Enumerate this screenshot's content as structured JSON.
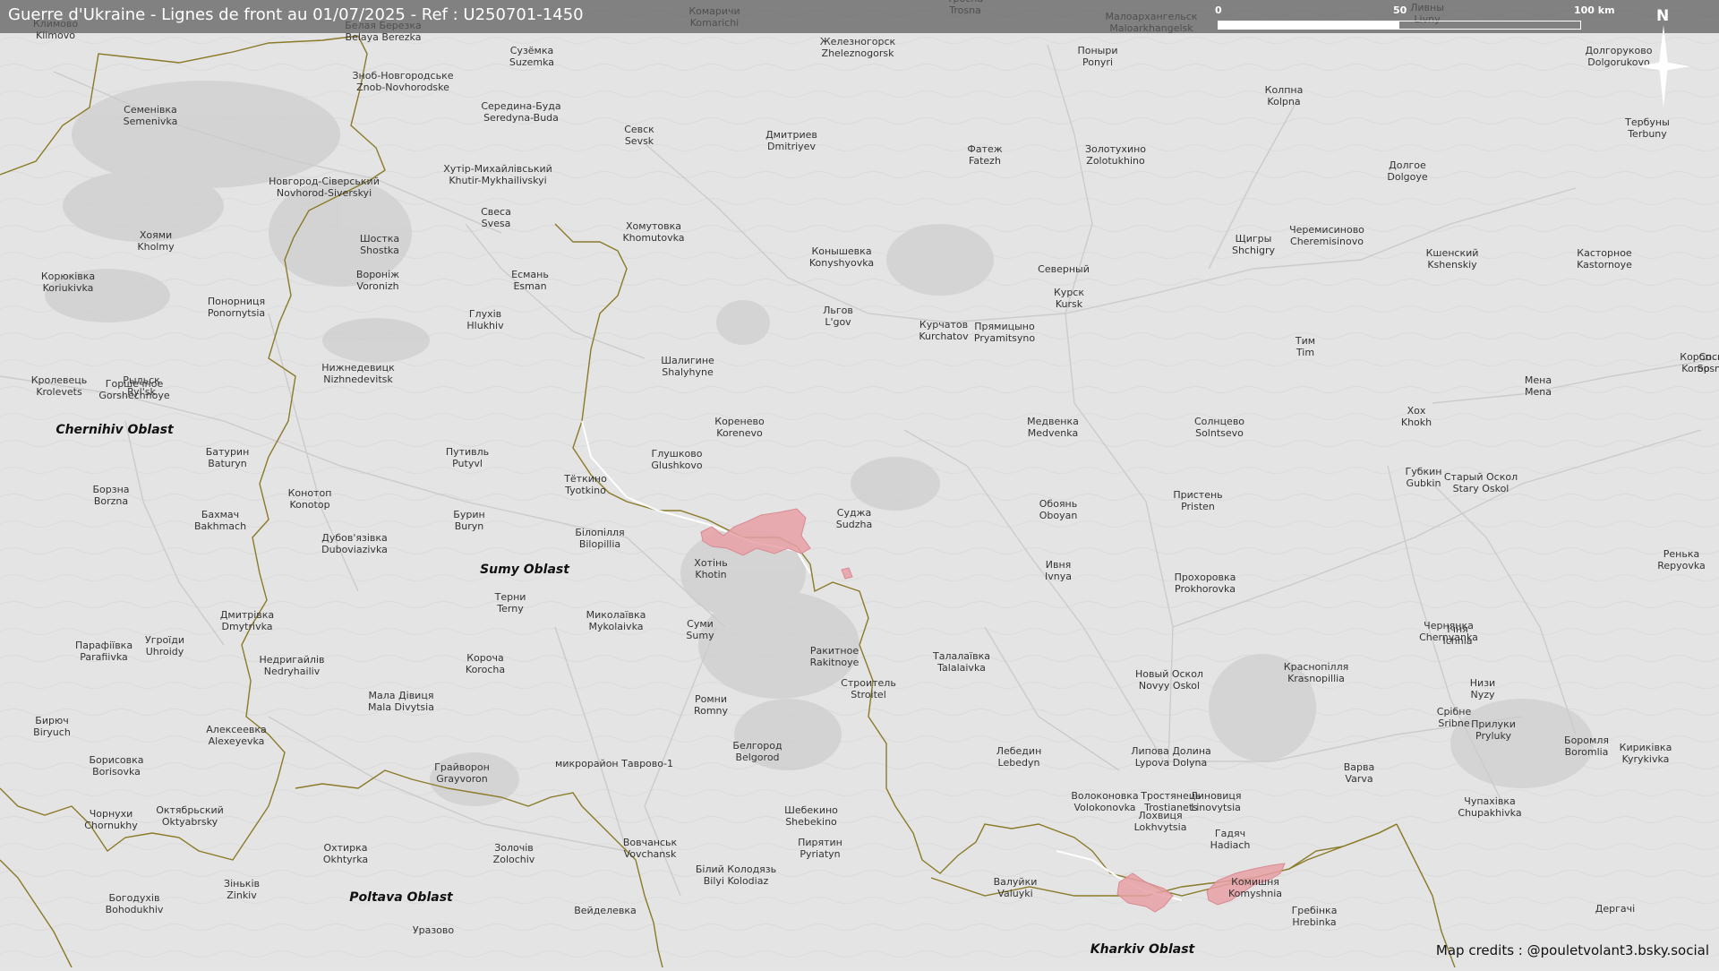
{
  "header": {
    "title": "Guerre d'Ukraine - Lignes de front au 01/07/2025 - Ref : U250701-1450",
    "scale_labels": [
      "0",
      "50",
      "100 km"
    ],
    "north_label": "N"
  },
  "footer": {
    "credits": "Map credits : @pouletvolant3.bsky.social"
  },
  "colors": {
    "occupied": "#e8a0a6",
    "border": "#8a7a28",
    "frontline": "#ffffff",
    "header_bg": "#5a5a5a"
  },
  "oblasts": [
    {
      "name": "Chernihiv Oblast"
    },
    {
      "name": "Sumy Oblast"
    },
    {
      "name": "Poltava Oblast"
    },
    {
      "name": "Kharkiv Oblast"
    }
  ],
  "places": [
    {
      "l1": "Комаричи",
      "l2": "Komarichi"
    },
    {
      "l1": "Тросна",
      "l2": "Trosna"
    },
    {
      "l1": "Малоархангельск",
      "l2": "Maloarkhangelsk"
    },
    {
      "l1": "Ливны",
      "l2": "Livny"
    },
    {
      "l1": "Климово",
      "l2": "Klimovo"
    },
    {
      "l1": "Белая Березка",
      "l2": "Belaya Berezka"
    },
    {
      "l1": "Сузёмка",
      "l2": "Suzemka"
    },
    {
      "l1": "Железногорск",
      "l2": "Zheleznogorsk"
    },
    {
      "l1": "Поныри",
      "l2": "Ponyri"
    },
    {
      "l1": "Долгоруково",
      "l2": "Dolgorukovo"
    },
    {
      "l1": "Зноб-Новгородське",
      "l2": "Znob-Novhorodske"
    },
    {
      "l1": "Семенівка",
      "l2": "Semenivka"
    },
    {
      "l1": "Середина-Буда",
      "l2": "Seredyna-Buda"
    },
    {
      "l1": "Севск",
      "l2": "Sevsk"
    },
    {
      "l1": "Дмитриев",
      "l2": "Dmitriyev"
    },
    {
      "l1": "Колпна",
      "l2": "Kolpna"
    },
    {
      "l1": "Тербуны",
      "l2": "Terbuny"
    },
    {
      "l1": "Фатеж",
      "l2": "Fatezh"
    },
    {
      "l1": "Золотухино",
      "l2": "Zolotukhino"
    },
    {
      "l1": "Долгое",
      "l2": "Dolgoye"
    },
    {
      "l1": "Новгород-Сіверський",
      "l2": "Novhorod-Siverskyi"
    },
    {
      "l1": "Хутір-Михайлівський",
      "l2": "Khutir-Mykhailivskyi"
    },
    {
      "l1": "Свеса",
      "l2": "Svesa"
    },
    {
      "l1": "Хомутовка",
      "l2": "Khomutovka"
    },
    {
      "l1": "Хоями",
      "l2": "Kholmy"
    },
    {
      "l1": "Шостка",
      "l2": "Shostka"
    },
    {
      "l1": "Конышевка",
      "l2": "Konyshyovka"
    },
    {
      "l1": "Щигры",
      "l2": "Shchigry"
    },
    {
      "l1": "Черемисиново",
      "l2": "Cheremisinovo"
    },
    {
      "l1": "Кшенский",
      "l2": "Kshenskiy"
    },
    {
      "l1": "Касторное",
      "l2": "Kastornoye"
    },
    {
      "l1": "Корюківка",
      "l2": "Koriukivka"
    },
    {
      "l1": "Вороніж",
      "l2": "Voronizh"
    },
    {
      "l1": "Есмань",
      "l2": "Esman"
    },
    {
      "l1": "Северный",
      "l2": ""
    },
    {
      "l1": "Курск",
      "l2": "Kursk"
    },
    {
      "l1": "Понорниця",
      "l2": "Ponornytsia"
    },
    {
      "l1": "Глухів",
      "l2": "Hlukhiv"
    },
    {
      "l1": "Льгов",
      "l2": "L'gov"
    },
    {
      "l1": "Курчатов",
      "l2": "Kurchatov"
    },
    {
      "l1": "Прямицыно",
      "l2": "Pryamitsyno"
    },
    {
      "l1": "Тим",
      "l2": "Tim"
    },
    {
      "l1": "Короп",
      "l2": "Korop"
    },
    {
      "l1": "Шалигине",
      "l2": "Shalyhyne"
    },
    {
      "l1": "Рыльск",
      "l2": "Ryl'sk"
    },
    {
      "l1": "Нижнедевицк",
      "l2": "Nizhnedevitsk"
    },
    {
      "l1": "Мена",
      "l2": "Mena"
    },
    {
      "l1": "Сосниця",
      "l2": "Sosnytsia"
    },
    {
      "l1": "Кролевець",
      "l2": "Krolevets"
    },
    {
      "l1": "Горшечное",
      "l2": "Gorshechnoye"
    },
    {
      "l1": "Хох",
      "l2": "Khokh"
    },
    {
      "l1": "Кореневo",
      "l2": "Korenevo"
    },
    {
      "l1": "Медвенка",
      "l2": "Medvenka"
    },
    {
      "l1": "Солнцево",
      "l2": "Solntsevo"
    },
    {
      "l1": "Путивль",
      "l2": "Putyvl"
    },
    {
      "l1": "Глушково",
      "l2": "Glushkovo"
    },
    {
      "l1": "Батурин",
      "l2": "Baturyn"
    },
    {
      "l1": "Тёткино",
      "l2": "Tyotkino"
    },
    {
      "l1": "Губкин",
      "l2": "Gubkin"
    },
    {
      "l1": "Старый Оскол",
      "l2": "Stary Oskol"
    },
    {
      "l1": "Борзна",
      "l2": "Borzna"
    },
    {
      "l1": "Конотоп",
      "l2": "Konotop"
    },
    {
      "l1": "Пристень",
      "l2": "Pristen"
    },
    {
      "l1": "Бахмач",
      "l2": "Bakhmach"
    },
    {
      "l1": "Бурин",
      "l2": "Buryn"
    },
    {
      "l1": "Суджа",
      "l2": "Sudzha"
    },
    {
      "l1": "Обоянь",
      "l2": "Oboyan"
    },
    {
      "l1": "Білопілля",
      "l2": "Bilopillia"
    },
    {
      "l1": "Дубов'язівка",
      "l2": "Duboviazivka"
    },
    {
      "l1": "Хотінь",
      "l2": "Khotin"
    },
    {
      "l1": "Ивня",
      "l2": "Ivnya"
    },
    {
      "l1": "Ренька",
      "l2": "Repyovka"
    },
    {
      "l1": "Прохоровка",
      "l2": "Prokhorovka"
    },
    {
      "l1": "Терни",
      "l2": "Terny"
    },
    {
      "l1": "Миколаївка",
      "l2": "Mykolaivka"
    },
    {
      "l1": "Чернянка",
      "l2": "Chernyanka"
    },
    {
      "l1": "Дмитрівка",
      "l2": "Dmytrivka"
    },
    {
      "l1": "Суми",
      "l2": "Sumy"
    },
    {
      "l1": "Ічня",
      "l2": "Ichnia"
    },
    {
      "l1": "Парафіївка",
      "l2": "Parafiivka"
    },
    {
      "l1": "Угроїди",
      "l2": "Uhroidy"
    },
    {
      "l1": "Ракитное",
      "l2": "Rakitnoye"
    },
    {
      "l1": "Талалаївка",
      "l2": "Talalaivka"
    },
    {
      "l1": "Недригайлів",
      "l2": "Nedryhailiv"
    },
    {
      "l1": "Короча",
      "l2": "Korocha"
    },
    {
      "l1": "Краснопілля",
      "l2": "Krasnopillia"
    },
    {
      "l1": "Строитель",
      "l2": "Stroitel"
    },
    {
      "l1": "Новый Оскол",
      "l2": "Novyy Oskol"
    },
    {
      "l1": "Низи",
      "l2": "Nyzy"
    },
    {
      "l1": "Ромни",
      "l2": "Romny"
    },
    {
      "l1": "Мала Дівиця",
      "l2": "Mala Divytsia"
    },
    {
      "l1": "Срібне",
      "l2": "Sribne"
    },
    {
      "l1": "Бирюч",
      "l2": "Biryuch"
    },
    {
      "l1": "Алексеевка",
      "l2": "Alexeyevka"
    },
    {
      "l1": "Прилуки",
      "l2": "Pryluky"
    },
    {
      "l1": "Боромля",
      "l2": "Boromlia"
    },
    {
      "l1": "Борисовка",
      "l2": "Borisovka"
    },
    {
      "l1": "Белгород",
      "l2": "Belgorod"
    },
    {
      "l1": "Лебедин",
      "l2": "Lebedyn"
    },
    {
      "l1": "Липова Долина",
      "l2": "Lypova Dolyna"
    },
    {
      "l1": "микрорайон Таврово-1",
      "l2": ""
    },
    {
      "l1": "Варва",
      "l2": "Varva"
    },
    {
      "l1": "Тростянець",
      "l2": "Trostianets"
    },
    {
      "l1": "Грайворон",
      "l2": "Grayvoron"
    },
    {
      "l1": "Волоконовка",
      "l2": "Volokonovka"
    },
    {
      "l1": "Линовиця",
      "l2": "Linovytsia"
    },
    {
      "l1": "Октябрьский",
      "l2": "Oktyabrsky"
    },
    {
      "l1": "Шебекино",
      "l2": "Shebekino"
    },
    {
      "l1": "Лохвиця",
      "l2": "Lokhvytsia"
    },
    {
      "l1": "Гадяч",
      "l2": "Hadiach"
    },
    {
      "l1": "Чупахівка",
      "l2": "Chupakhivka"
    },
    {
      "l1": "Кириківка",
      "l2": "Kyrykivka"
    },
    {
      "l1": "Чорнухи",
      "l2": "Chornukhy"
    },
    {
      "l1": "Охтирка",
      "l2": "Okhtyrka"
    },
    {
      "l1": "Золочів",
      "l2": "Zolochiv"
    },
    {
      "l1": "Вовчанськ",
      "l2": "Vovchansk"
    },
    {
      "l1": "Пирятин",
      "l2": "Pyriatyn"
    },
    {
      "l1": "Зіньків",
      "l2": "Zinkiv"
    },
    {
      "l1": "Білий Колодязь",
      "l2": "Bilyi Kolodiaz"
    },
    {
      "l1": "Валуйки",
      "l2": "Valuyki"
    },
    {
      "l1": "Комишня",
      "l2": "Komyshnia"
    },
    {
      "l1": "Богодухів",
      "l2": "Bohodukhiv"
    },
    {
      "l1": "Вейделевка",
      "l2": ""
    },
    {
      "l1": "Гребінка",
      "l2": "Hrebinka"
    },
    {
      "l1": "Дергачі",
      "l2": ""
    },
    {
      "l1": "Уразово",
      "l2": ""
    }
  ]
}
